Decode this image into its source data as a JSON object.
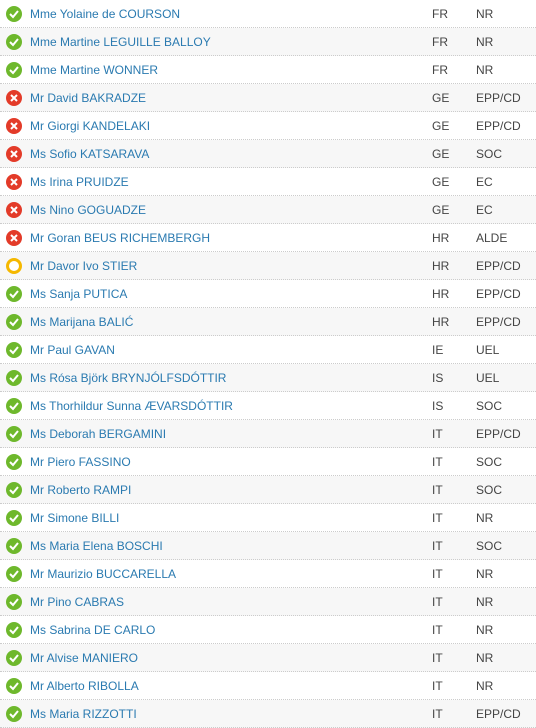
{
  "rows": [
    {
      "vote": "for",
      "name": "Mme Yolaine de COURSON",
      "country": "FR",
      "group": "NR"
    },
    {
      "vote": "for",
      "name": "Mme Martine LEGUILLE BALLOY",
      "country": "FR",
      "group": "NR"
    },
    {
      "vote": "for",
      "name": "Mme Martine WONNER",
      "country": "FR",
      "group": "NR"
    },
    {
      "vote": "against",
      "name": "Mr David BAKRADZE",
      "country": "GE",
      "group": "EPP/CD"
    },
    {
      "vote": "against",
      "name": "Mr Giorgi KANDELAKI",
      "country": "GE",
      "group": "EPP/CD"
    },
    {
      "vote": "against",
      "name": "Ms Sofio KATSARAVA",
      "country": "GE",
      "group": "SOC"
    },
    {
      "vote": "against",
      "name": "Ms Irina PRUIDZE",
      "country": "GE",
      "group": "EC"
    },
    {
      "vote": "against",
      "name": "Ms Nino GOGUADZE",
      "country": "GE",
      "group": "EC"
    },
    {
      "vote": "against",
      "name": "Mr Goran BEUS RICHEMBERGH",
      "country": "HR",
      "group": "ALDE"
    },
    {
      "vote": "abstain",
      "name": "Mr Davor Ivo STIER",
      "country": "HR",
      "group": "EPP/CD"
    },
    {
      "vote": "for",
      "name": "Ms Sanja PUTICA",
      "country": "HR",
      "group": "EPP/CD"
    },
    {
      "vote": "for",
      "name": "Ms Marijana BALIĆ",
      "country": "HR",
      "group": "EPP/CD"
    },
    {
      "vote": "for",
      "name": "Mr Paul GAVAN",
      "country": "IE",
      "group": "UEL"
    },
    {
      "vote": "for",
      "name": "Ms Rósa Björk BRYNJÓLFSDÓTTIR",
      "country": "IS",
      "group": "UEL"
    },
    {
      "vote": "for",
      "name": "Ms Thorhildur Sunna ÆVARSDÓTTIR",
      "country": "IS",
      "group": "SOC"
    },
    {
      "vote": "for",
      "name": "Ms Deborah BERGAMINI",
      "country": "IT",
      "group": "EPP/CD"
    },
    {
      "vote": "for",
      "name": "Mr Piero FASSINO",
      "country": "IT",
      "group": "SOC"
    },
    {
      "vote": "for",
      "name": "Mr Roberto RAMPI",
      "country": "IT",
      "group": "SOC"
    },
    {
      "vote": "for",
      "name": "Mr Simone BILLI",
      "country": "IT",
      "group": "NR"
    },
    {
      "vote": "for",
      "name": "Ms Maria Elena BOSCHI",
      "country": "IT",
      "group": "SOC"
    },
    {
      "vote": "for",
      "name": "Mr Maurizio BUCCARELLA",
      "country": "IT",
      "group": "NR"
    },
    {
      "vote": "for",
      "name": "Mr Pino CABRAS",
      "country": "IT",
      "group": "NR"
    },
    {
      "vote": "for",
      "name": "Ms Sabrina DE CARLO",
      "country": "IT",
      "group": "NR"
    },
    {
      "vote": "for",
      "name": "Mr Alvise MANIERO",
      "country": "IT",
      "group": "NR"
    },
    {
      "vote": "for",
      "name": "Mr Alberto RIBOLLA",
      "country": "IT",
      "group": "NR"
    },
    {
      "vote": "for",
      "name": "Ms Maria RIZZOTTI",
      "country": "IT",
      "group": "EPP/CD"
    }
  ]
}
